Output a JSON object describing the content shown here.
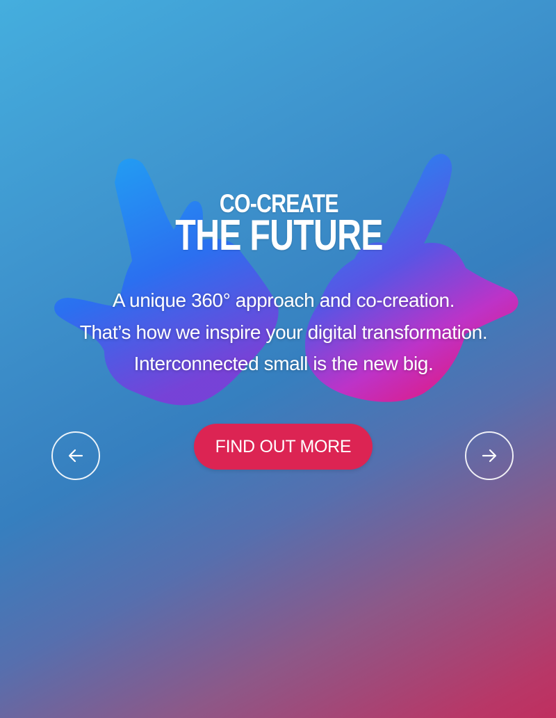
{
  "hero": {
    "heading_line1": "CO-CREATE",
    "heading_line2": "THE FUTURE",
    "tagline": [
      "A unique 360° approach and co-creation.",
      "That’s how we inspire your digital transformation.",
      "Interconnected small is the new big."
    ],
    "cta_label": "FIND OUT MORE"
  },
  "carousel": {
    "prev_icon": "arrow-left-icon",
    "next_icon": "arrow-right-icon"
  },
  "colors": {
    "cta_background": "#dc2453",
    "gradient_start": "#45aede",
    "gradient_end": "#c02f5f",
    "text": "#ffffff"
  }
}
